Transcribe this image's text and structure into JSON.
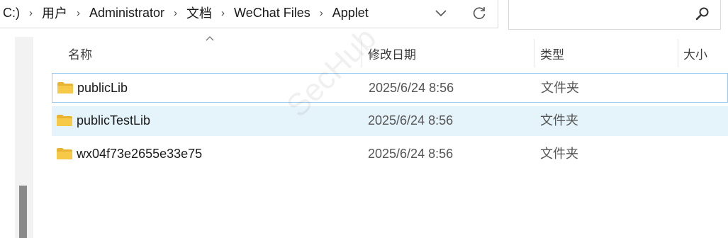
{
  "address_bar": {
    "crumbs": [
      "C:)",
      "用户",
      "Administrator",
      "文档",
      "WeChat Files",
      "Applet"
    ],
    "dropdown_icon": "chevron-down-icon",
    "refresh_icon": "refresh-icon"
  },
  "search": {
    "placeholder": "",
    "icon": "search-icon"
  },
  "columns": {
    "name": "名称",
    "modified": "修改日期",
    "type": "类型",
    "size": "大小"
  },
  "files": [
    {
      "name": "publicLib",
      "modified": "2025/6/24 8:56",
      "type": "文件夹",
      "size": ""
    },
    {
      "name": "publicTestLib",
      "modified": "2025/6/24 8:56",
      "type": "文件夹",
      "size": ""
    },
    {
      "name": "wx04f73e2655e33e75",
      "modified": "2025/6/24 8:56",
      "type": "文件夹",
      "size": ""
    }
  ],
  "watermark": "SecHub",
  "colors": {
    "folder": "#f7c948",
    "hover_row": "#e5f3fb",
    "focus_border": "#99c9ef"
  }
}
